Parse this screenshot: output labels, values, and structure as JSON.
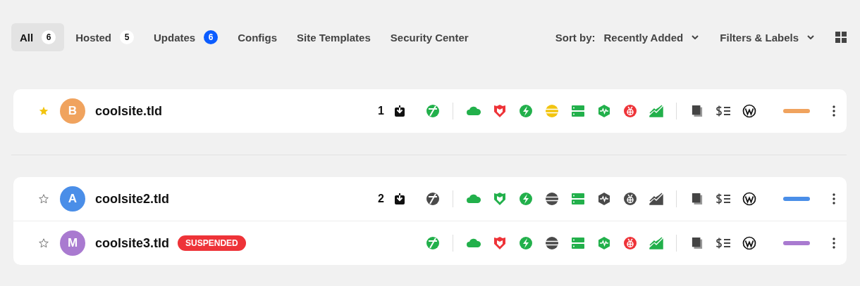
{
  "tabs": [
    {
      "label": "All",
      "count": "6",
      "selected": true,
      "count_highlight": false
    },
    {
      "label": "Hosted",
      "count": "5",
      "selected": false,
      "count_highlight": false
    },
    {
      "label": "Updates",
      "count": "6",
      "selected": false,
      "count_highlight": true
    },
    {
      "label": "Configs",
      "selected": false
    },
    {
      "label": "Site Templates",
      "selected": false
    },
    {
      "label": "Security Center",
      "selected": false
    }
  ],
  "sort": {
    "label": "Sort by:",
    "value": "Recently Added"
  },
  "filters": {
    "label": "Filters & Labels"
  },
  "groups": [
    {
      "sites": [
        {
          "starred": true,
          "avatar": {
            "letter": "B",
            "color": "#f0a35e"
          },
          "name": "coolsite.tld",
          "updates": "1",
          "tools": [
            {
              "kind": "leaf",
              "color": "#22b04b"
            },
            {
              "kind": "cloud",
              "color": "#22b04b"
            },
            {
              "kind": "shield",
              "color": "#ee3338"
            },
            {
              "kind": "bolt",
              "color": "#22b04b"
            },
            {
              "kind": "stripes",
              "color": "#f2c40f"
            },
            {
              "kind": "server",
              "color": "#22b04b"
            },
            {
              "kind": "hexagon",
              "color": "#22b04b"
            },
            {
              "kind": "bug",
              "color": "#ee3338"
            },
            {
              "kind": "chart",
              "color": "#22b04b"
            }
          ],
          "label": {
            "color": "#f0a35e"
          }
        }
      ]
    },
    {
      "sites": [
        {
          "starred": false,
          "avatar": {
            "letter": "A",
            "color": "#4a8ee8"
          },
          "name": "coolsite2.tld",
          "updates": "2",
          "tools": [
            {
              "kind": "leaf",
              "color": "#4a4a4a"
            },
            {
              "kind": "cloud",
              "color": "#22b04b"
            },
            {
              "kind": "shield",
              "color": "#22b04b"
            },
            {
              "kind": "bolt",
              "color": "#22b04b"
            },
            {
              "kind": "stripes",
              "color": "#4a4a4a"
            },
            {
              "kind": "server",
              "color": "#22b04b"
            },
            {
              "kind": "hexagon",
              "color": "#4a4a4a"
            },
            {
              "kind": "bug",
              "color": "#4a4a4a"
            },
            {
              "kind": "chart",
              "color": "#4a4a4a"
            }
          ],
          "label": {
            "color": "#4a8ee8"
          }
        },
        {
          "starred": false,
          "avatar": {
            "letter": "M",
            "color": "#a97ad0"
          },
          "name": "coolsite3.tld",
          "badge": "SUSPENDED",
          "tools": [
            {
              "kind": "leaf",
              "color": "#22b04b"
            },
            {
              "kind": "cloud",
              "color": "#22b04b"
            },
            {
              "kind": "shield",
              "color": "#ee3338"
            },
            {
              "kind": "bolt",
              "color": "#22b04b"
            },
            {
              "kind": "stripes",
              "color": "#4a4a4a"
            },
            {
              "kind": "server",
              "color": "#22b04b"
            },
            {
              "kind": "hexagon",
              "color": "#22b04b"
            },
            {
              "kind": "bug",
              "color": "#ee3338"
            },
            {
              "kind": "chart",
              "color": "#22b04b"
            }
          ],
          "label": {
            "color": "#a97ad0"
          }
        }
      ]
    }
  ]
}
